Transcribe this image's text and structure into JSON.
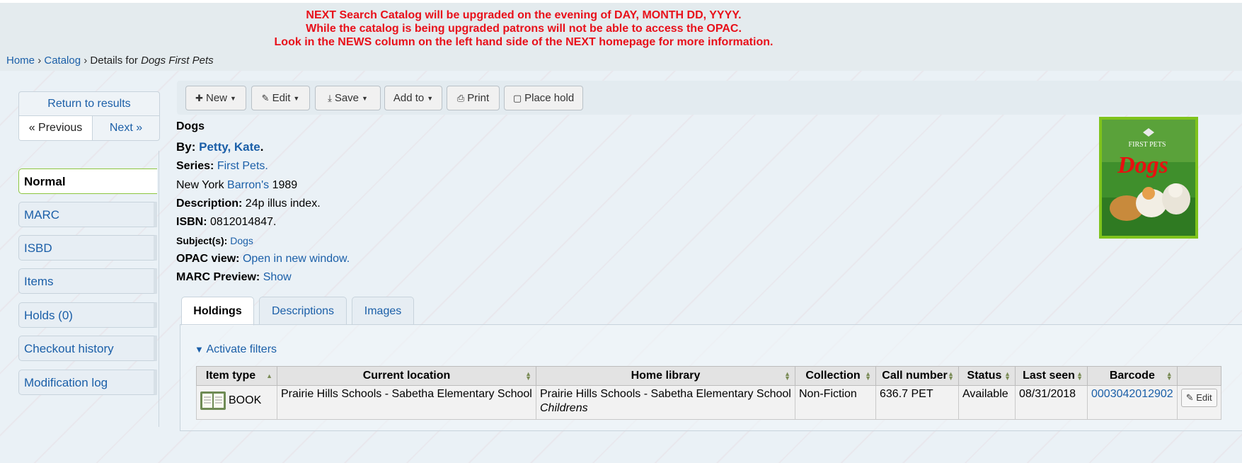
{
  "banner": {
    "lines": [
      "NEXT Search Catalog will be upgraded on the evening of DAY, MONTH DD, YYYY.",
      "While the catalog is being upgraded patrons will not be able to access the OPAC.",
      "Look in the NEWS column on the left hand side of the NEXT homepage for more information."
    ],
    "color": "#e8101a"
  },
  "breadcrumb": {
    "home": "Home",
    "sep": "›",
    "catalog": "Catalog",
    "details_prefix": "Details for",
    "title": "Dogs First Pets"
  },
  "pager": {
    "return": "Return to results",
    "previous": "« Previous",
    "next": "Next »"
  },
  "sidebar": {
    "items": [
      {
        "label": "Normal",
        "active": true
      },
      {
        "label": "MARC"
      },
      {
        "label": "ISBD"
      },
      {
        "label": "Items"
      },
      {
        "label": "Holds (0)"
      },
      {
        "label": "Checkout history"
      },
      {
        "label": "Modification log"
      }
    ]
  },
  "toolbar": {
    "new": "New",
    "edit": "Edit",
    "save": "Save",
    "add_to": "Add to",
    "print": "Print",
    "place_hold": "Place hold"
  },
  "record": {
    "title": "Dogs",
    "by_label": "By:",
    "author": "Petty, Kate",
    "author_suffix": ".",
    "series_label": "Series:",
    "series": "First Pets.",
    "pub_place": "New York",
    "publisher": "Barron's",
    "pub_year": "1989",
    "description_label": "Description:",
    "description": "24p illus index.",
    "isbn_label": "ISBN:",
    "isbn": "0812014847.",
    "subjects_label": "Subject(s):",
    "subject": "Dogs",
    "opac_label": "OPAC view:",
    "opac_link": "Open in new window.",
    "marc_preview_label": "MARC Preview:",
    "marc_preview_link": "Show"
  },
  "cover": {
    "series_text": "FIRST PETS",
    "title_text": "Dogs"
  },
  "tabs": [
    {
      "label": "Holdings",
      "active": true
    },
    {
      "label": "Descriptions"
    },
    {
      "label": "Images"
    }
  ],
  "filters": {
    "label": "Activate filters"
  },
  "holdings": {
    "columns": [
      "Item type",
      "Current location",
      "Home library",
      "Collection",
      "Call number",
      "Status",
      "Last seen",
      "Barcode",
      ""
    ],
    "rows": [
      {
        "item_type": "BOOK",
        "current_location": "Prairie Hills Schools - Sabetha Elementary School",
        "home_library": "Prairie Hills Schools - Sabetha Elementary School",
        "shelving": "Childrens",
        "collection": "Non-Fiction",
        "call_number": "636.7 PET",
        "status": "Available",
        "last_seen": "08/31/2018",
        "barcode": "0003042012902",
        "edit": "Edit"
      }
    ]
  },
  "colors": {
    "link": "#1b5fa8",
    "active_border": "#8cc63f",
    "background": "#eaf1f6"
  }
}
